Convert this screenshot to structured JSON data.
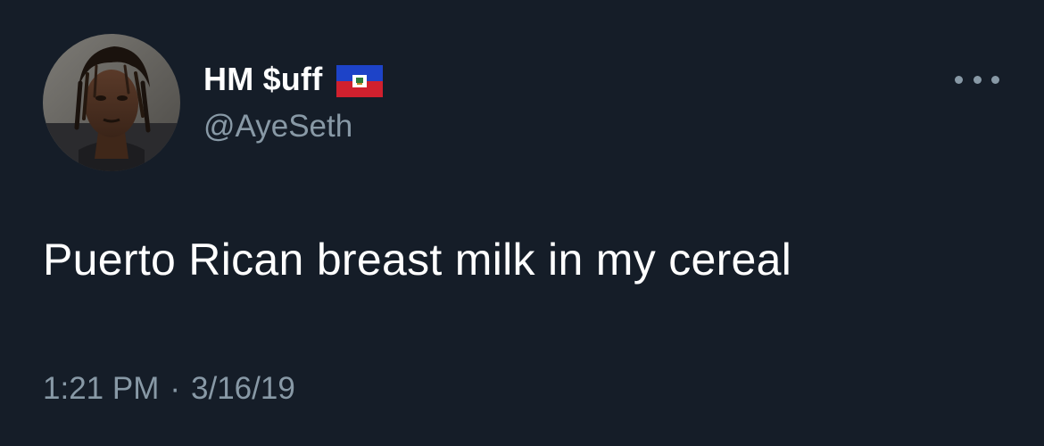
{
  "tweet": {
    "display_name": "HM $uff",
    "handle": "@AyeSeth",
    "flag_icon": "haiti-flag-icon",
    "more_icon": "more-options-icon",
    "text": "Puerto Rican breast milk in my cereal",
    "time": "1:21 PM",
    "separator": "·",
    "date": "3/16/19"
  },
  "colors": {
    "background": "#151d28",
    "primary_text": "#ffffff",
    "secondary_text": "#8899a6"
  }
}
